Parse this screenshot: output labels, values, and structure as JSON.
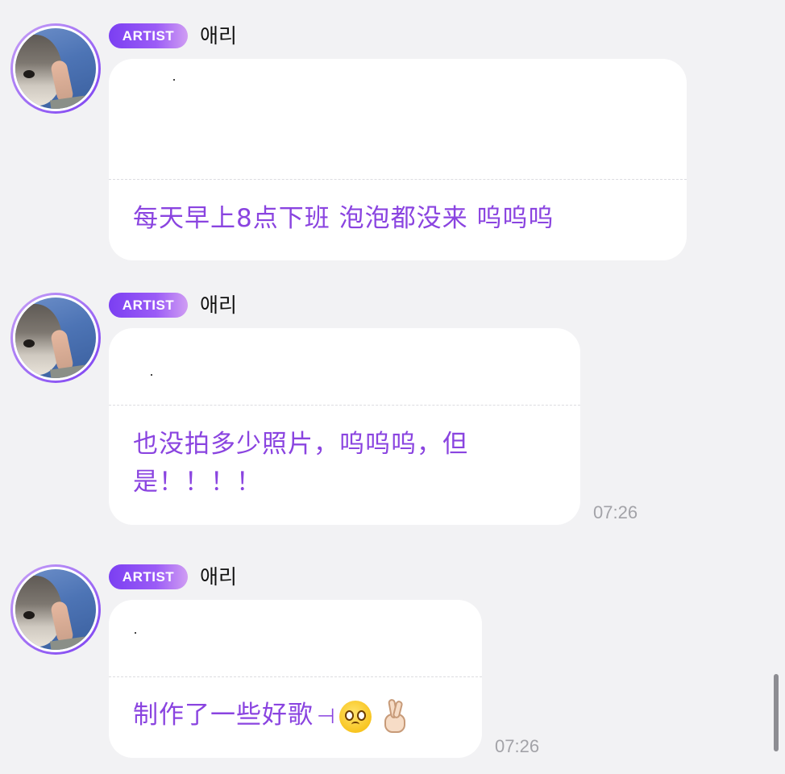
{
  "messages": [
    {
      "badge": "ARTIST",
      "name": "애리",
      "text": "每天早上8点下班 泡泡都没来 呜呜呜",
      "time": ""
    },
    {
      "badge": "ARTIST",
      "name": "애리",
      "text": "也没拍多少照片，呜呜呜，但是！！！！",
      "time": "07:26"
    },
    {
      "badge": "ARTIST",
      "name": "애리",
      "text": "制作了一些好歌",
      "time": "07:26"
    }
  ],
  "icons": {
    "emoji_1": "pleading-face-icon",
    "emoji_2": "crossed-fingers-icon"
  },
  "colors": {
    "accent": "#8a44e0",
    "badge_start": "#7b3ff2",
    "badge_end": "#d09df3",
    "background": "#f2f2f4",
    "bubble": "#ffffff",
    "time": "#a3a3a8"
  }
}
